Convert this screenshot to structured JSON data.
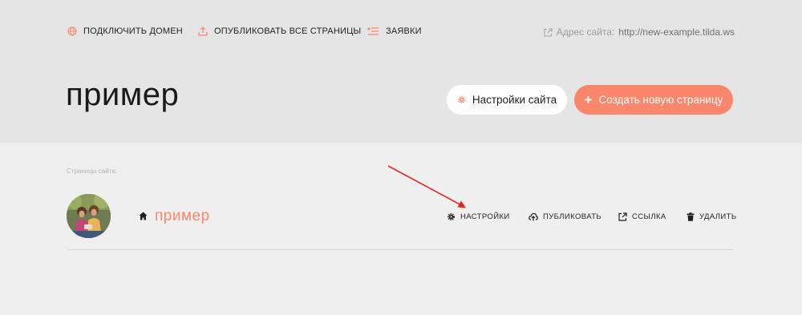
{
  "topbar": {
    "connect_domain": "Подключить домен",
    "publish_all": "Опубликовать все страницы",
    "leads": "Заявки",
    "site_address_label": "Адрес сайта:",
    "site_address_url": "http://new-example.tilda.ws"
  },
  "project": {
    "title": "пример"
  },
  "buttons": {
    "site_settings": "Настройки сайта",
    "create_page_plus": "+",
    "create_page": "Создать новую страницу"
  },
  "pages": {
    "section_label": "Страницы сайта:",
    "items": [
      {
        "name": "пример",
        "actions": {
          "settings": "Настройки",
          "publish": "Публиковать",
          "link": "Ссылка",
          "delete": "Удалить"
        }
      }
    ]
  },
  "icons": {
    "connect_domain": "globe-icon",
    "publish_all": "upload-icon",
    "leads": "list-plus-icon",
    "site_address": "external-link-icon",
    "site_settings": "gear-icon",
    "home": "home-icon",
    "page_settings": "gear-icon",
    "page_publish": "cloud-upload-icon",
    "page_link": "external-link-icon",
    "page_delete": "trash-icon"
  },
  "colors": {
    "accent": "#fa876b",
    "header_bg": "#e5e5e5",
    "body_bg": "#efefef",
    "annotation_arrow": "#e8241e"
  }
}
